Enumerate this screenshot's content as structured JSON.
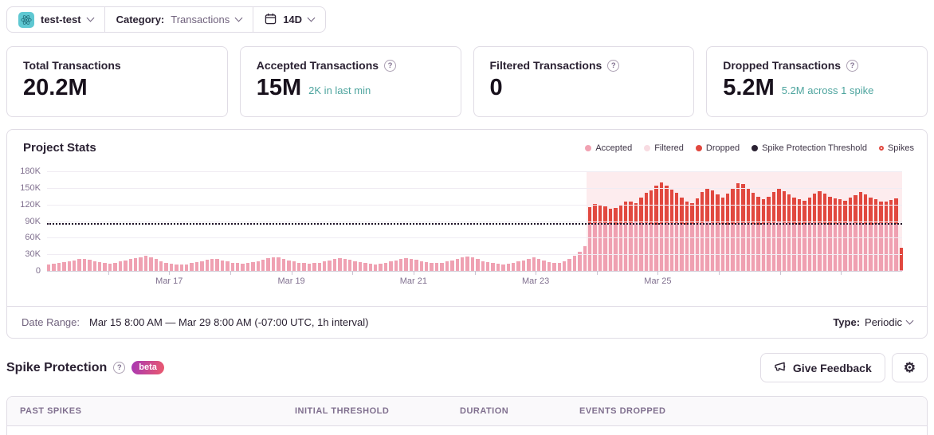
{
  "topbar": {
    "project_name": "test-test",
    "category_label": "Category:",
    "category_value": "Transactions",
    "date_range_value": "14D"
  },
  "cards": [
    {
      "title": "Total Transactions",
      "value": "20.2M",
      "subtext": ""
    },
    {
      "title": "Accepted Transactions",
      "value": "15M",
      "subtext": "2K in last min"
    },
    {
      "title": "Filtered Transactions",
      "value": "0",
      "subtext": ""
    },
    {
      "title": "Dropped Transactions",
      "value": "5.2M",
      "subtext": "5.2M across 1 spike"
    }
  ],
  "chart": {
    "title": "Project Stats",
    "legend": [
      {
        "label": "Accepted",
        "color": "#F1A2B2",
        "type": "dot"
      },
      {
        "label": "Filtered",
        "color": "#F8DCE2",
        "type": "dot"
      },
      {
        "label": "Dropped",
        "color": "#E1483F",
        "type": "dot"
      },
      {
        "label": "Spike Protection Threshold",
        "color": "#2B2233",
        "type": "dot"
      },
      {
        "label": "Spikes",
        "color": "#E1483F",
        "type": "ring"
      }
    ]
  },
  "chart_data": {
    "type": "bar",
    "stacked": true,
    "title": "Project Stats",
    "units": "K",
    "ylim": [
      0,
      180
    ],
    "y_tick_labels": [
      "180K",
      "150K",
      "120K",
      "90K",
      "60K",
      "30K",
      "0"
    ],
    "x_labels": [
      "Mar 17",
      "Mar 19",
      "Mar 21",
      "Mar 23",
      "Mar 25"
    ],
    "days_shown": 14,
    "threshold": 84,
    "spike_start_index": 106,
    "accepted": [
      12,
      13,
      15,
      16,
      18,
      19,
      21,
      22,
      20,
      18,
      16,
      14,
      13,
      15,
      17,
      19,
      21,
      23,
      25,
      27,
      24,
      21,
      18,
      15,
      13,
      12,
      11,
      12,
      14,
      16,
      18,
      20,
      22,
      21,
      19,
      17,
      15,
      14,
      13,
      14,
      16,
      18,
      20,
      23,
      25,
      24,
      22,
      19,
      17,
      15,
      14,
      13,
      14,
      15,
      17,
      19,
      21,
      23,
      22,
      20,
      18,
      16,
      14,
      13,
      12,
      13,
      15,
      17,
      19,
      21,
      23,
      22,
      20,
      18,
      16,
      15,
      14,
      15,
      17,
      19,
      21,
      24,
      26,
      24,
      21,
      18,
      16,
      14,
      13,
      12,
      13,
      15,
      17,
      19,
      22,
      24,
      22,
      19,
      16,
      14,
      15,
      18,
      22,
      27,
      35,
      45,
      85,
      86,
      87,
      86,
      85,
      84,
      85,
      86,
      87,
      88,
      87,
      86,
      85,
      84,
      85,
      86,
      87,
      86,
      85,
      84,
      85,
      86,
      87,
      88,
      87,
      86,
      85,
      84,
      85,
      86,
      87,
      86,
      85,
      84,
      85,
      86,
      87,
      88,
      87,
      86,
      85,
      84,
      85,
      86,
      87,
      86,
      85,
      84,
      85,
      86,
      87,
      88,
      87,
      86,
      85,
      84,
      85,
      86,
      87,
      86,
      85,
      2
    ],
    "dropped_spike": [
      30,
      35,
      32,
      30,
      28,
      30,
      35,
      40,
      38,
      35,
      45,
      55,
      60,
      70,
      75,
      68,
      60,
      55,
      48,
      42,
      38,
      45,
      55,
      62,
      58,
      52,
      48,
      55,
      65,
      72,
      70,
      62,
      56,
      50,
      45,
      48,
      55,
      60,
      57,
      52,
      48,
      45,
      42,
      46,
      52,
      58,
      55,
      50,
      46,
      43,
      40,
      44,
      50,
      56,
      53,
      48,
      44,
      40,
      38,
      42,
      46,
      40
    ],
    "colors": {
      "accepted": "#F1A2B2",
      "dropped": "#E1483F",
      "threshold": "#1D1127",
      "spike_region": "#FBE7EA"
    }
  },
  "date_range": {
    "label": "Date Range:",
    "value": "Mar 15 8:00 AM — Mar 29 8:00 AM (-07:00 UTC, 1h interval)",
    "type_label": "Type:",
    "type_value": "Periodic"
  },
  "spike_protection": {
    "title": "Spike Protection",
    "badge": "beta",
    "feedback_button": "Give Feedback"
  },
  "table": {
    "headers": [
      "PAST SPIKES",
      "INITIAL THRESHOLD",
      "DURATION",
      "EVENTS DROPPED"
    ]
  }
}
